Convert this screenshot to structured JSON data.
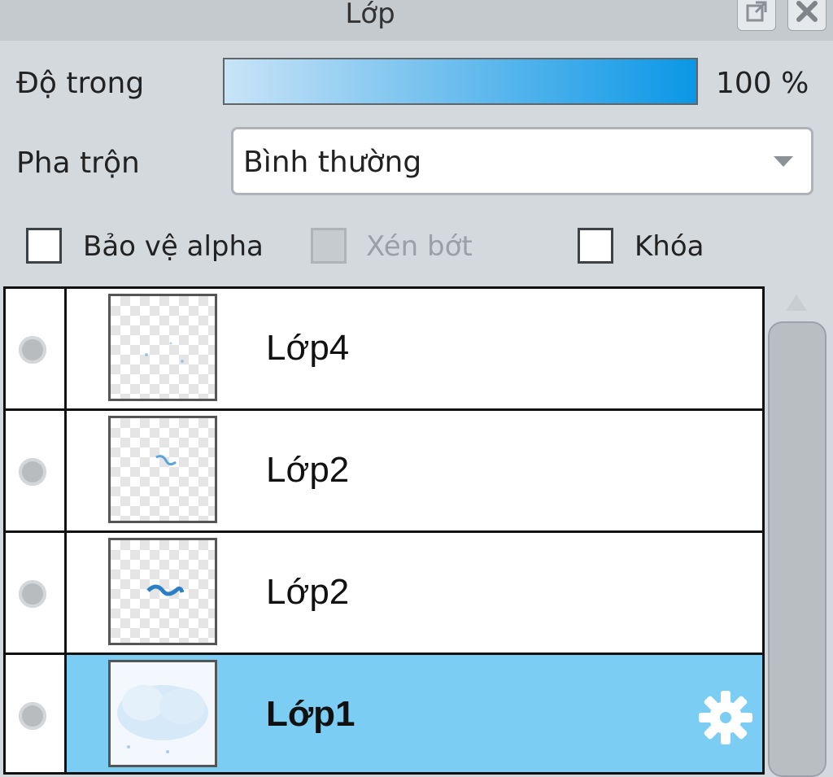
{
  "panel": {
    "title": "Lớp"
  },
  "opacity": {
    "label": "Độ trong",
    "value": "100 %",
    "percent": 100
  },
  "blend": {
    "label": "Pha trộn",
    "value": "Bình thường"
  },
  "options": {
    "protect_alpha": "Bảo vệ alpha",
    "clipping": "Xén bớt",
    "lock": "Khóa"
  },
  "layers": [
    {
      "name": "Lớp4",
      "selected": false
    },
    {
      "name": "Lớp2",
      "selected": false
    },
    {
      "name": "Lớp2",
      "selected": false
    },
    {
      "name": "Lớp1",
      "selected": true
    }
  ],
  "colors": {
    "accent": "#0a97e6",
    "selection": "#7ccdf4",
    "panel_bg": "#d4d9de"
  }
}
